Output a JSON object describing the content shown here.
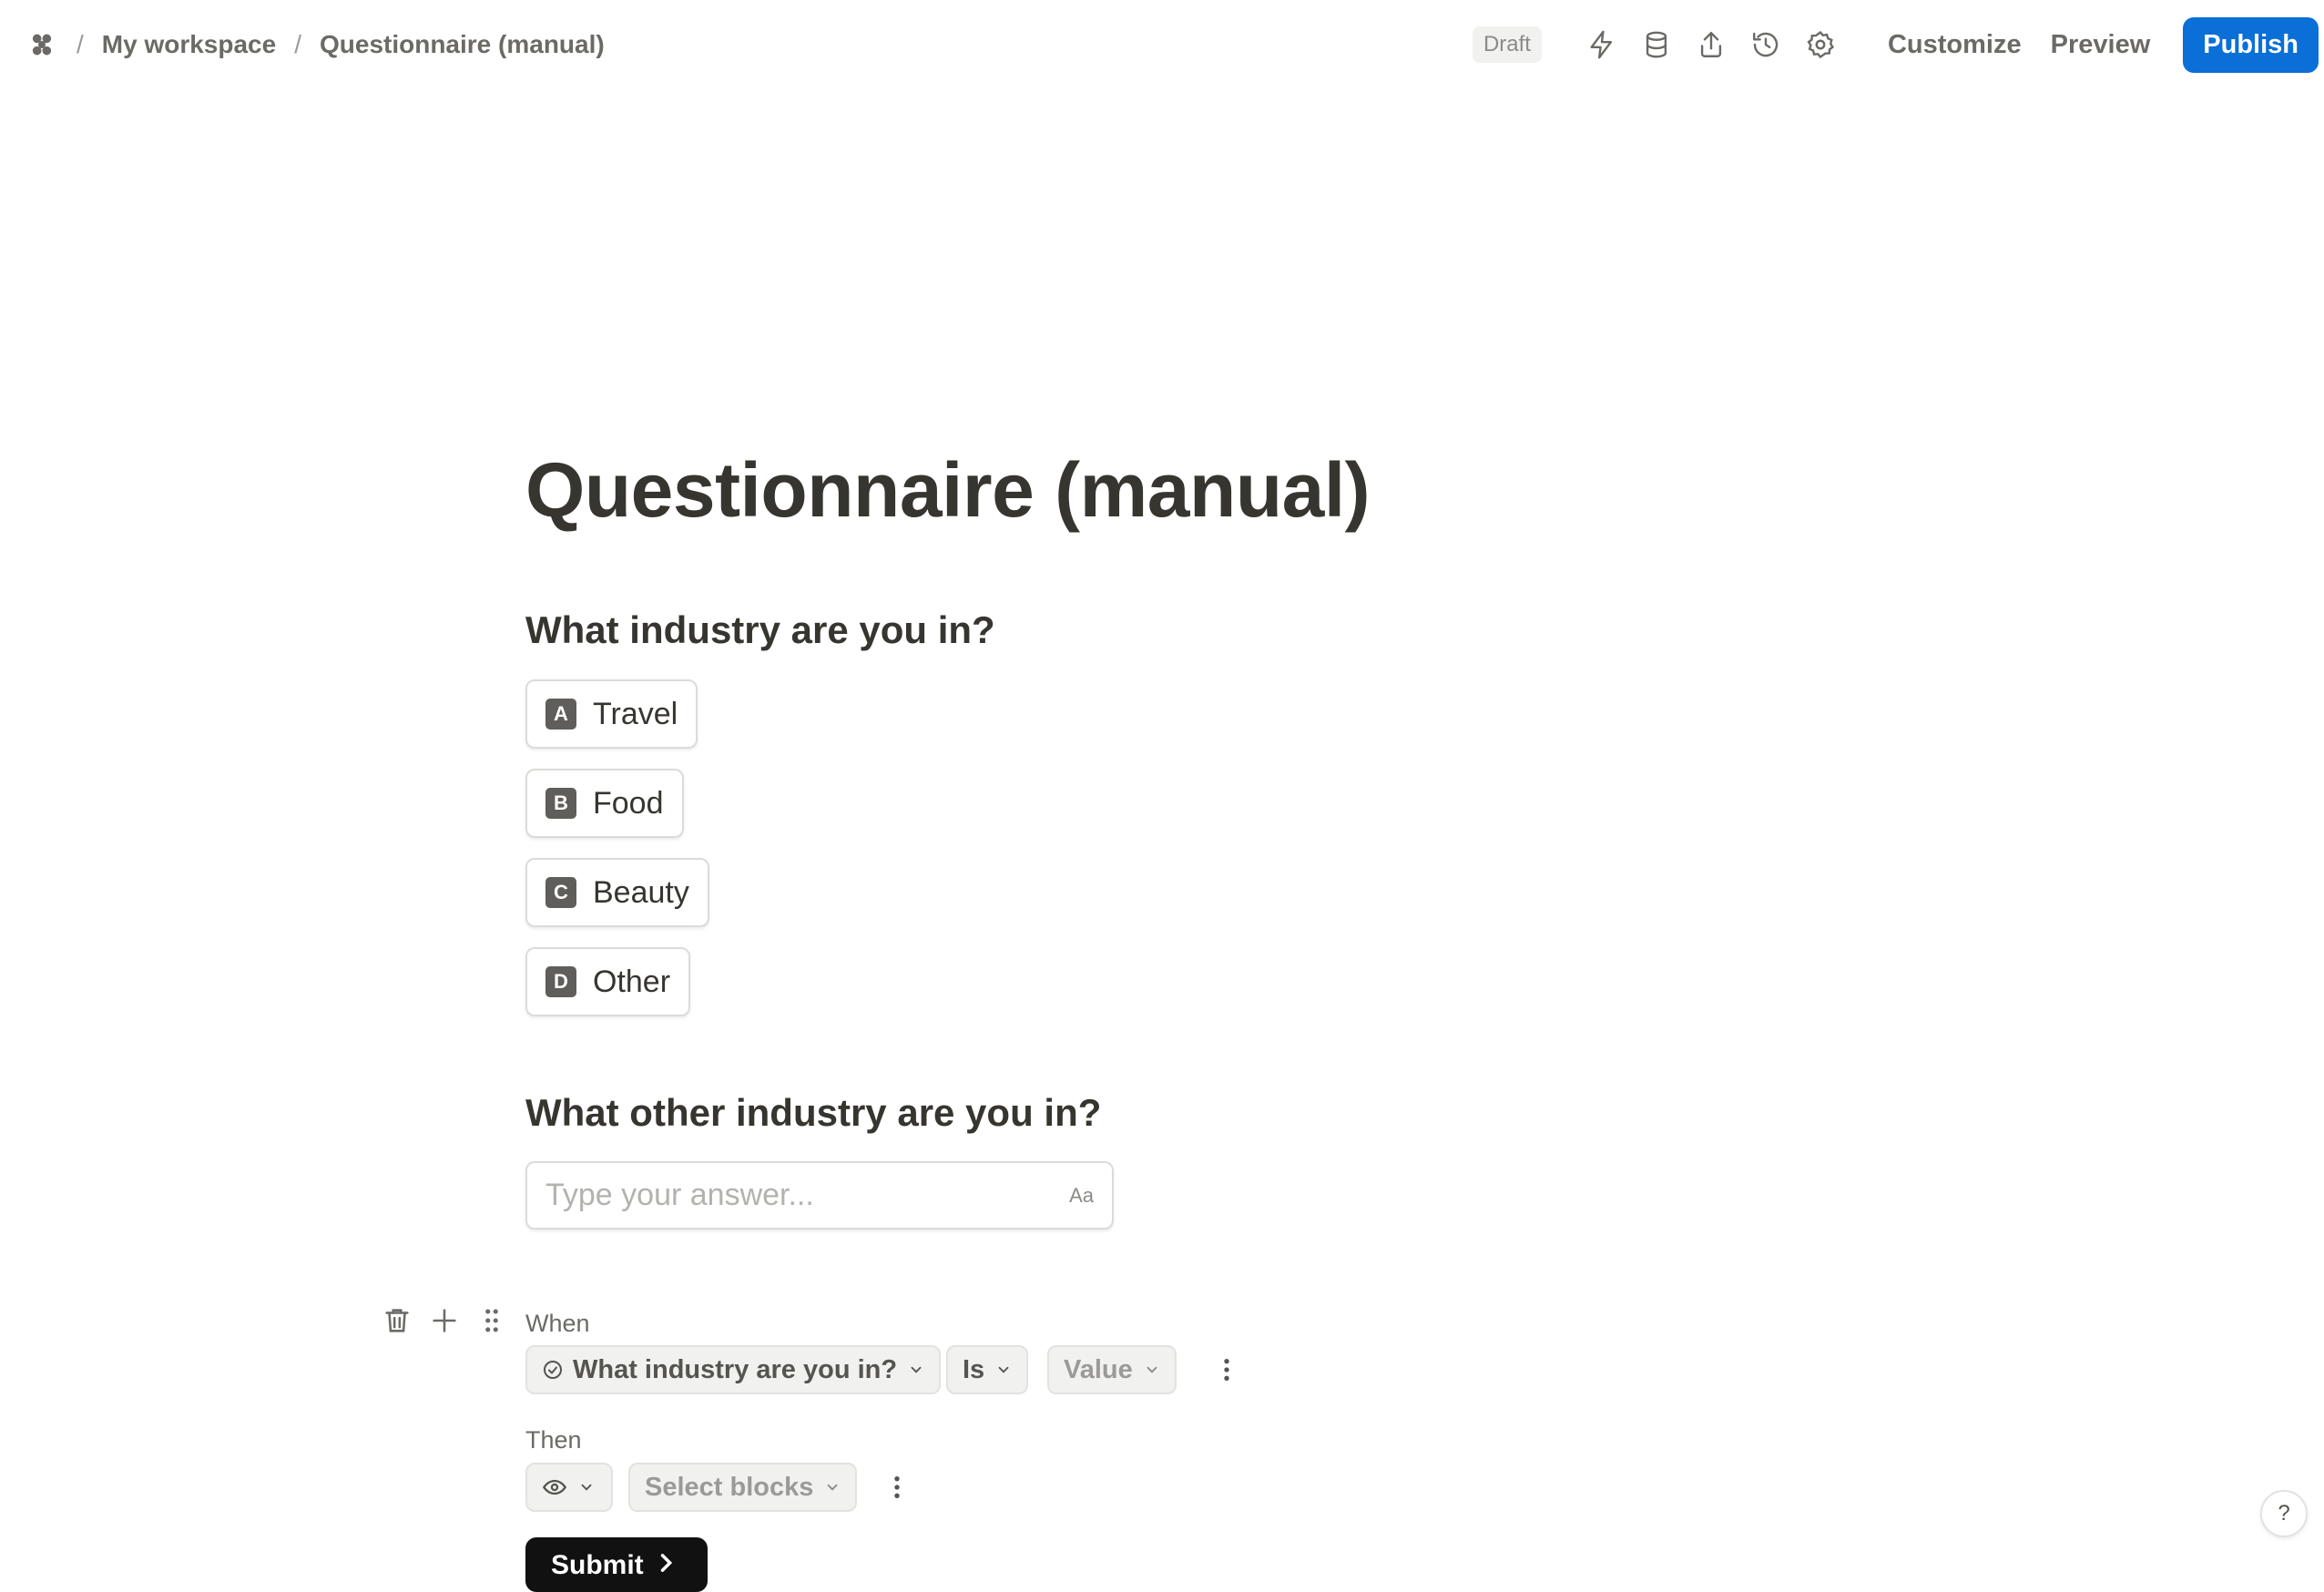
{
  "breadcrumb": {
    "logo_icon": "tally-logo-icon",
    "separator": "/",
    "items": [
      "My workspace",
      "Questionnaire (manual)"
    ]
  },
  "toolbar": {
    "status": "Draft",
    "icons": [
      "integrations-bolt-icon",
      "database-icon",
      "share-icon",
      "history-icon",
      "settings-gear-icon"
    ],
    "customize_label": "Customize",
    "preview_label": "Preview",
    "publish_label": "Publish",
    "publish_color": "#0a6fd6"
  },
  "form": {
    "title": "Questionnaire (manual)",
    "question1": {
      "label": "What industry are you in?",
      "choices": [
        {
          "key": "A",
          "label": "Travel"
        },
        {
          "key": "B",
          "label": "Food"
        },
        {
          "key": "C",
          "label": "Beauty"
        },
        {
          "key": "D",
          "label": "Other"
        }
      ]
    },
    "question2": {
      "label": "What other industry are you in?",
      "placeholder": "Type your answer...",
      "type_hint": "Aa"
    },
    "logic": {
      "when_label": "When",
      "field": "What industry are you in?",
      "operator": "Is",
      "value": "Value",
      "then_label": "Then",
      "action_icon": "eye-icon",
      "target": "Select blocks"
    },
    "submit_label": "Submit"
  },
  "help_label": "?"
}
